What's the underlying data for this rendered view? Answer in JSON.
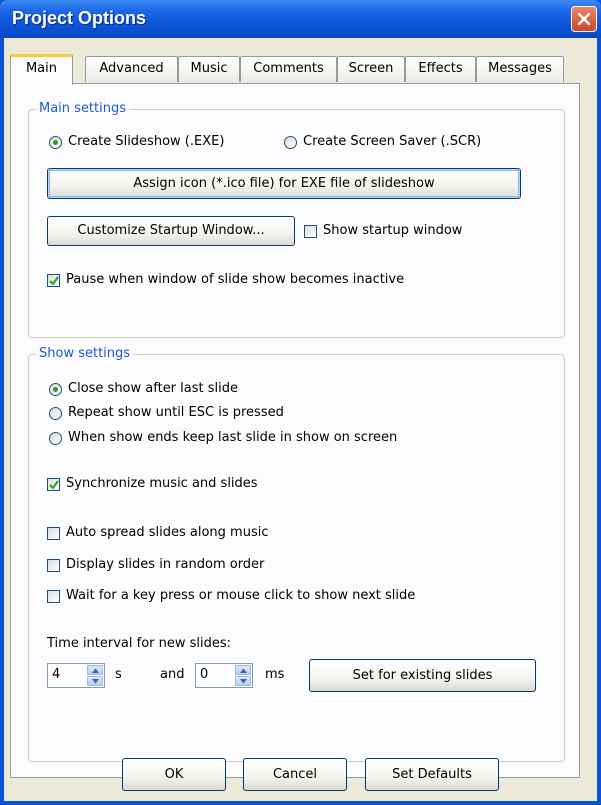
{
  "window": {
    "title": "Project Options"
  },
  "tabs": [
    "Main",
    "Advanced",
    "Music",
    "Comments",
    "Screen",
    "Effects",
    "Messages"
  ],
  "main_settings": {
    "title": "Main settings",
    "radio_exe": "Create Slideshow (.EXE)",
    "radio_scr": "Create Screen Saver (.SCR)",
    "assign_icon_button": "Assign icon (*.ico file) for EXE file of slideshow",
    "customize_startup_button": "Customize Startup Window...",
    "show_startup_label": "Show startup window",
    "show_startup_checked": false,
    "pause_label": "Pause when window of slide show becomes inactive",
    "pause_checked": true,
    "selected_mode": "exe"
  },
  "show_settings": {
    "title": "Show settings",
    "end_options": [
      "Close show after last slide",
      "Repeat show until ESC is pressed",
      "When show ends keep last slide in show on screen"
    ],
    "selected_end_option": 0,
    "sync_label": "Synchronize music and slides",
    "sync_checked": true,
    "auto_spread_label": "Auto spread slides along music",
    "random_order_label": "Display slides in random order",
    "wait_key_label": "Wait for a key press or mouse click to show next slide",
    "interval_label": "Time interval for new slides:",
    "seconds_value": "4",
    "seconds_unit": "s",
    "and_label": "and",
    "ms_value": "0",
    "ms_unit": "ms",
    "set_existing_button": "Set for existing slides"
  },
  "footer": {
    "ok": "OK",
    "cancel": "Cancel",
    "set_defaults": "Set Defaults"
  }
}
